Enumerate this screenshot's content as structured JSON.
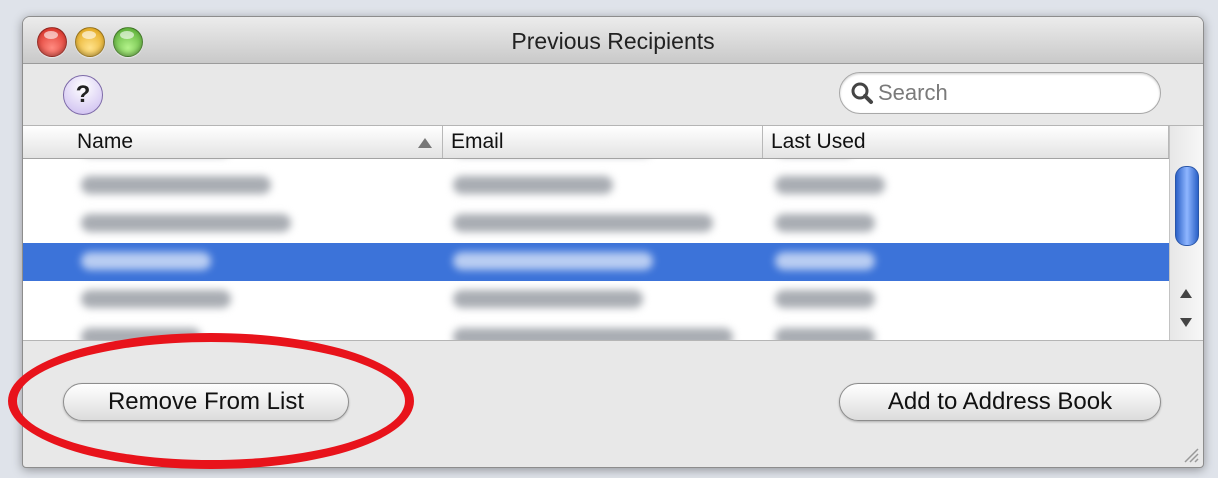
{
  "window": {
    "title": "Previous Recipients"
  },
  "toolbar": {
    "help_label": "?",
    "search_placeholder": "Search"
  },
  "table": {
    "columns": [
      {
        "label": "Name",
        "sort": "ascending"
      },
      {
        "label": "Email"
      },
      {
        "label": "Last Used"
      }
    ],
    "rows_count_visible": 6,
    "selected_row_index": 3,
    "note": ""
  },
  "buttons": {
    "remove": "Remove From List",
    "add_to_address_book": "Add to Address Book"
  },
  "annotation": {
    "ring_color": "#e8131b"
  },
  "colors": {
    "selection": "#3c73d9"
  }
}
